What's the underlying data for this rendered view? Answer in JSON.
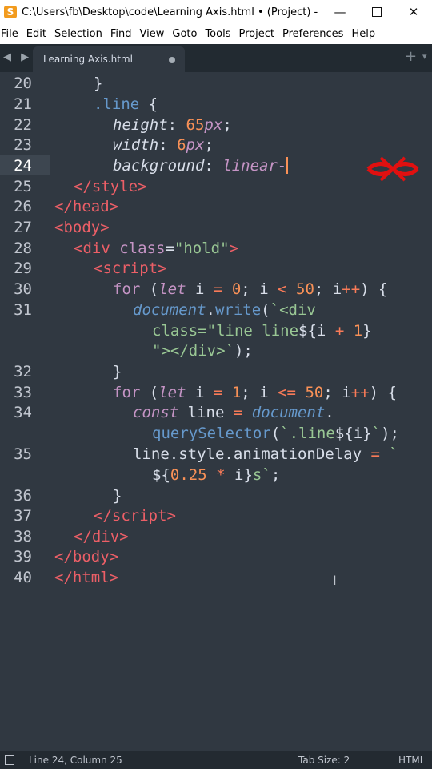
{
  "window": {
    "title": "C:\\Users\\fb\\Desktop\\code\\Learning Axis.html • (Project) - Su...",
    "app_icon": "S",
    "minimize_icon": "minimize-icon",
    "maximize_icon": "maximize-icon",
    "close_icon": "close-icon"
  },
  "menu": [
    "File",
    "Edit",
    "Selection",
    "Find",
    "View",
    "Goto",
    "Tools",
    "Project",
    "Preferences",
    "Help"
  ],
  "tabs": {
    "active_label": "Learning Axis.html",
    "nav": "◀ ▶",
    "plus": "+",
    "overflow": "▾"
  },
  "editor": {
    "line_numbers": [
      "20",
      "21",
      "22",
      "23",
      "24",
      "25",
      "26",
      "27",
      "28",
      "29",
      "30",
      "31",
      "",
      "",
      "32",
      "33",
      "34",
      "",
      "35",
      "",
      "36",
      "37",
      "38",
      "39",
      "40"
    ],
    "current_line": "24"
  },
  "status": {
    "position": "Line 24, Column 25",
    "tab_size": "Tab Size: 2",
    "syntax": "HTML"
  },
  "colors": {
    "background": "#303841",
    "tag": "#ec5f67",
    "string": "#99c794",
    "number": "#f99157",
    "keyword": "#c594c5",
    "object": "#6699cc",
    "logo": "#e01010"
  }
}
